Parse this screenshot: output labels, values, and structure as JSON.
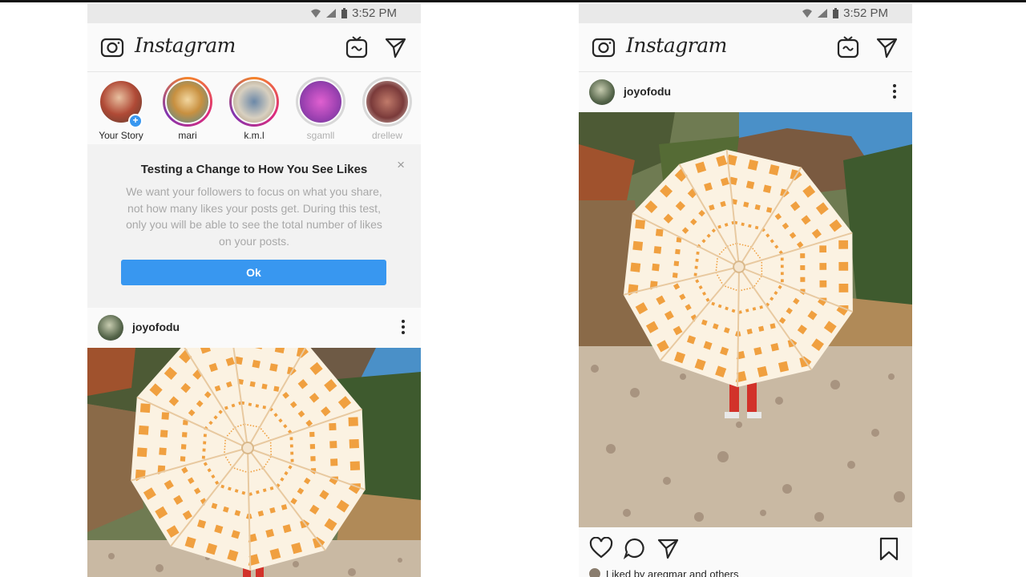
{
  "status": {
    "time": "3:52 PM"
  },
  "app": {
    "title": "Instagram"
  },
  "icons": {
    "camera": "camera-icon",
    "igtv": "igtv-icon",
    "direct": "direct-message-icon",
    "heart": "heart-icon",
    "comment": "comment-icon",
    "share": "share-icon",
    "bookmark": "bookmark-icon",
    "more": "more-options-icon"
  },
  "stories": [
    {
      "label": "Your Story",
      "state": "own"
    },
    {
      "label": "mari",
      "state": "new"
    },
    {
      "label": "k.m.l",
      "state": "new"
    },
    {
      "label": "sgamll",
      "state": "seen"
    },
    {
      "label": "drellew",
      "state": "seen"
    }
  ],
  "notice": {
    "title": "Testing a Change to How You See Likes",
    "body": "We want your followers to focus on what you share, not how many likes your posts get. During this test, only you will be able to see the total number of likes on your posts.",
    "button": "Ok",
    "close": "×"
  },
  "post": {
    "username": "joyofodu",
    "liked_by": "Liked by aregmar and others"
  },
  "colors": {
    "accent": "#3897f0",
    "umbrella_stripe": "#f0a040",
    "sky": "#4a90c8"
  }
}
